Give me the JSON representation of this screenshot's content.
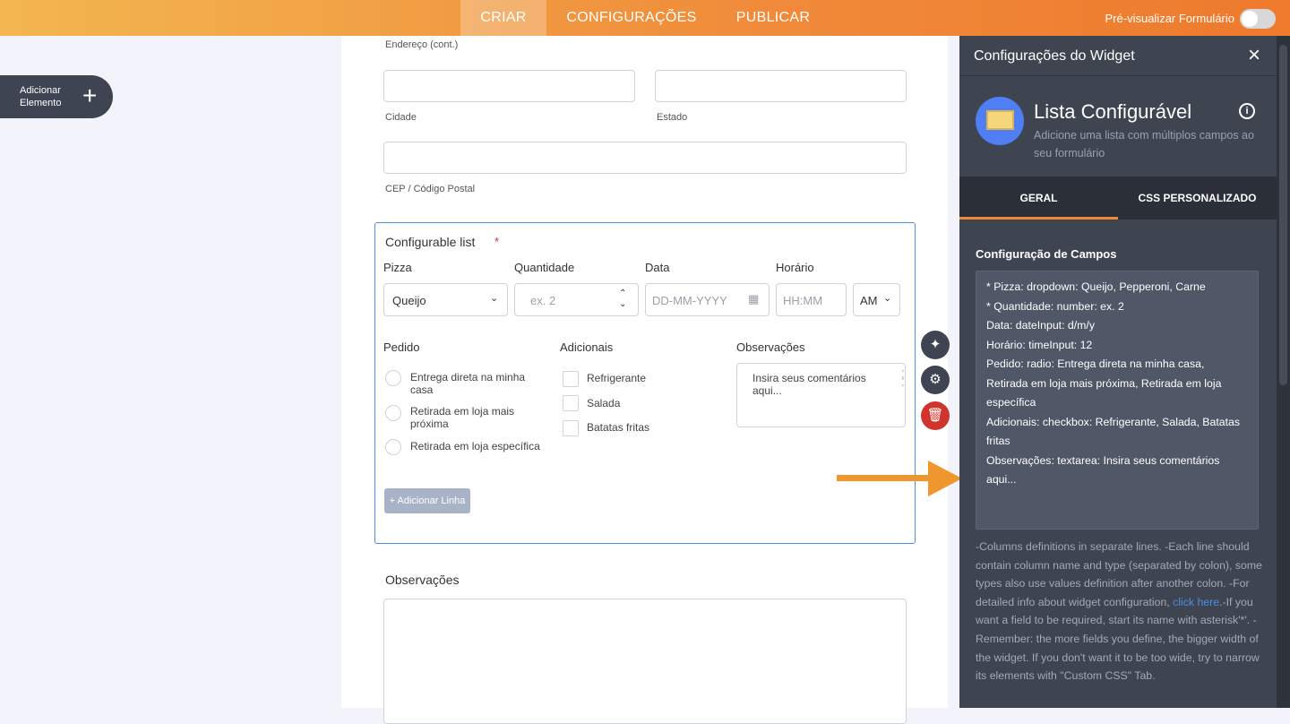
{
  "topbar": {
    "tabs": [
      "CRIAR",
      "CONFIGURAÇÕES",
      "PUBLICAR"
    ],
    "preview_label": "Pré-visualizar Formulário"
  },
  "sidebar": {
    "add_element": "Adicionar Elemento"
  },
  "form": {
    "address_cont": "Endereço (cont.)",
    "city": "Cidade",
    "state": "Estado",
    "zip": "CEP / Código Postal",
    "list": {
      "title": "Configurable list",
      "required": "*",
      "columns": [
        "Pizza",
        "Quantidade",
        "Data",
        "Horário"
      ],
      "pizza_value": "Queijo",
      "qty_placeholder": "ex. 2",
      "date_placeholder": "DD-MM-YYYY",
      "time_placeholder": "HH:MM",
      "ampm": "AM",
      "pedido": {
        "label": "Pedido",
        "options": [
          "Entrega direta na minha casa",
          "Retirada em loja mais próxima",
          "Retirada em loja específica"
        ]
      },
      "adicionais": {
        "label": "Adicionais",
        "options": [
          "Refrigerante",
          "Salada",
          "Batatas fritas"
        ]
      },
      "observacoes": {
        "label": "Observações",
        "placeholder": "Insira seus comentários aqui..."
      },
      "add_row": "+ Adicionar Linha"
    },
    "observacoes_label": "Observações"
  },
  "panel": {
    "title": "Configurações do Widget",
    "widget_name": "Lista Configurável",
    "widget_desc": "Adicione uma lista com múltiplos campos ao seu formulário",
    "tabs": [
      "GERAL",
      "CSS PERSONALIZADO"
    ],
    "section": "Configuração de Campos",
    "config_lines": [
      "* Pizza: dropdown: Queijo, Pepperoni, Carne",
      "* Quantidade: number: ex. 2",
      "Data: dateInput: d/m/y",
      "Horário: timeInput: 12",
      "Pedido: radio: Entrega direta na minha casa, Retirada em loja mais próxima, Retirada em loja específica",
      "Adicionais: checkbox: Refrigerante, Salada, Batatas fritas",
      "Observações: textarea: Insira seus comentários aqui..."
    ],
    "help_before": "-Columns definitions in separate lines. -Each line should contain column name and type (separated by colon), some types also use values definition after another colon. -For detailed info about widget configuration, ",
    "help_link": "click here",
    "help_after": ".-If you want a field to be required, start its name with asterisk'*'. -Remember: the more fields you define, the bigger width of the widget. If you don't want it to be too wide, try to narrow its elements with \"Custom CSS\" Tab."
  },
  "colors": {
    "accent": "#f08a3a",
    "panel": "#3f4451",
    "selection": "#4a90e2",
    "delete": "#d0342c"
  }
}
